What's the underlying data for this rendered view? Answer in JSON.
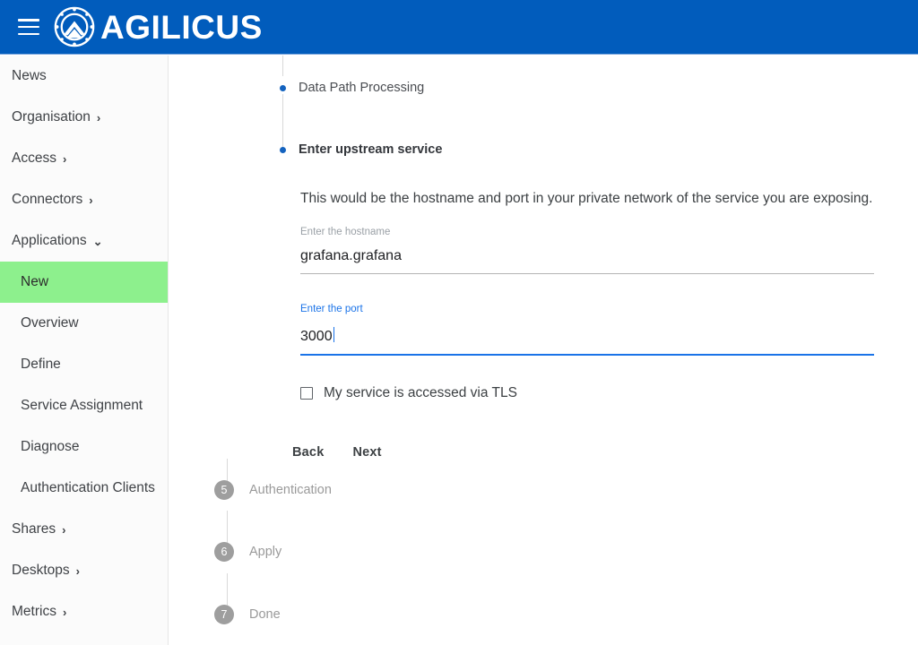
{
  "header": {
    "menu_icon": "hamburger-menu-icon",
    "logo_icon": "agilicus-logo-icon",
    "brand": "AGILICUS",
    "brand_color": "#015cbc"
  },
  "sidebar": {
    "active_highlight_color": "#8df08d",
    "items": [
      {
        "label": "News",
        "expandable": false,
        "sub": false,
        "active": false,
        "chevron": ""
      },
      {
        "label": "Organisation",
        "expandable": true,
        "sub": false,
        "active": false,
        "chevron": "›"
      },
      {
        "label": "Access",
        "expandable": true,
        "sub": false,
        "active": false,
        "chevron": "›"
      },
      {
        "label": "Connectors",
        "expandable": true,
        "sub": false,
        "active": false,
        "chevron": "›"
      },
      {
        "label": "Applications",
        "expandable": true,
        "sub": false,
        "active": false,
        "chevron": "⌄"
      },
      {
        "label": "New",
        "expandable": false,
        "sub": true,
        "active": true,
        "chevron": ""
      },
      {
        "label": "Overview",
        "expandable": false,
        "sub": true,
        "active": false,
        "chevron": ""
      },
      {
        "label": "Define",
        "expandable": false,
        "sub": true,
        "active": false,
        "chevron": ""
      },
      {
        "label": "Service Assignment",
        "expandable": false,
        "sub": true,
        "active": false,
        "chevron": ""
      },
      {
        "label": "Diagnose",
        "expandable": false,
        "sub": true,
        "active": false,
        "chevron": ""
      },
      {
        "label": "Authentication Clients",
        "expandable": false,
        "sub": true,
        "active": false,
        "chevron": ""
      },
      {
        "label": "Shares",
        "expandable": true,
        "sub": false,
        "active": false,
        "chevron": "›"
      },
      {
        "label": "Desktops",
        "expandable": true,
        "sub": false,
        "active": false,
        "chevron": "›"
      },
      {
        "label": "Metrics",
        "expandable": true,
        "sub": false,
        "active": false,
        "chevron": "›"
      }
    ]
  },
  "wizard": {
    "substeps": [
      {
        "label": "Data Path Processing",
        "current": false
      },
      {
        "label": "Enter upstream service",
        "current": true
      }
    ],
    "help_text": "This would be the hostname and port in your private network of the service you are exposing.",
    "fields": [
      {
        "label": "Enter the hostname",
        "value": "grafana.grafana",
        "focused": false
      },
      {
        "label": "Enter the port",
        "value": "3000",
        "focused": true
      }
    ],
    "tls_checkbox": {
      "label": "My service is accessed via TLS",
      "checked": false
    },
    "buttons": {
      "back": "Back",
      "next": "Next"
    },
    "steps": [
      {
        "num": "5",
        "label": "Authentication"
      },
      {
        "num": "6",
        "label": "Apply"
      },
      {
        "num": "7",
        "label": "Done"
      }
    ]
  }
}
